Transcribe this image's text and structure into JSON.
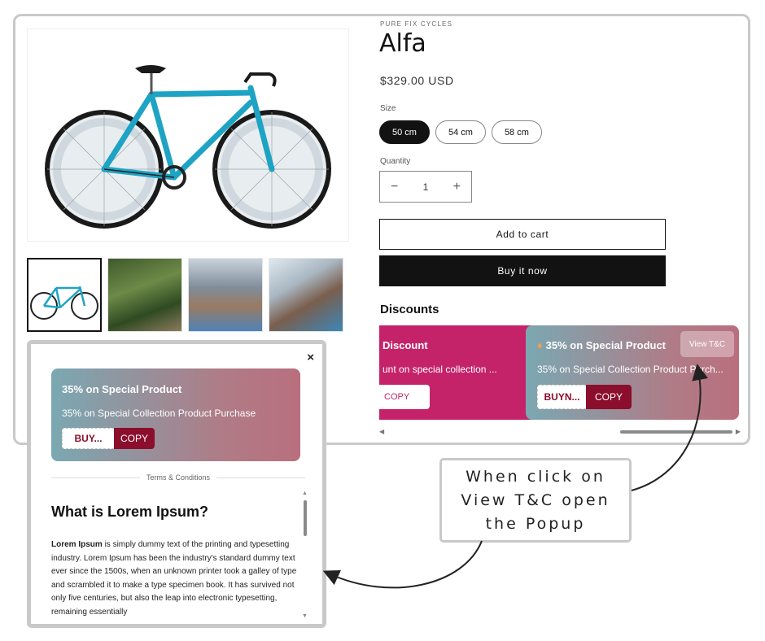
{
  "product": {
    "vendor": "PURE FIX CYCLES",
    "title": "Alfa",
    "price": "$329.00 USD",
    "size_label": "Size",
    "sizes": [
      "50 cm",
      "54 cm",
      "58 cm"
    ],
    "selected_size": "50 cm",
    "quantity_label": "Quantity",
    "quantity": "1",
    "qty_minus": "−",
    "qty_plus": "+",
    "add_to_cart": "Add to cart",
    "buy_now": "Buy it now"
  },
  "discounts": {
    "title": "Discounts",
    "cards": [
      {
        "title": "Discount",
        "description": "unt on special collection ...",
        "copy": "COPY",
        "color": "#c4236a"
      },
      {
        "title": "35% on Special Product",
        "description": "35% on Special Collection Product Purch...",
        "code": "BUYN...",
        "copy": "COPY",
        "tc_button": "View T&C",
        "icon": "tag-icon"
      }
    ]
  },
  "popup": {
    "close": "×",
    "card_title": "35% on Special Product",
    "card_description": "35% on Special Collection Product Purchase",
    "code": "BUY...",
    "copy": "COPY",
    "divider": "Terms & Conditions",
    "heading": "What is Lorem Ipsum?",
    "body_bold": "Lorem Ipsum",
    "body_text": " is simply dummy text of the printing and typesetting industry. Lorem Ipsum has been the industry's standard dummy text ever since the 1500s, when an unknown printer took a galley of type and scrambled it to make a type specimen book. It has survived not only five centuries, but also the leap into electronic typesetting, remaining essentially"
  },
  "callout": {
    "line1": "When click on",
    "line2": "View T&C open",
    "line3": "the Popup"
  },
  "colors": {
    "accent_dark": "#121212",
    "discount_pink": "#c4236a",
    "copy_maroon": "#8b0e2c"
  }
}
